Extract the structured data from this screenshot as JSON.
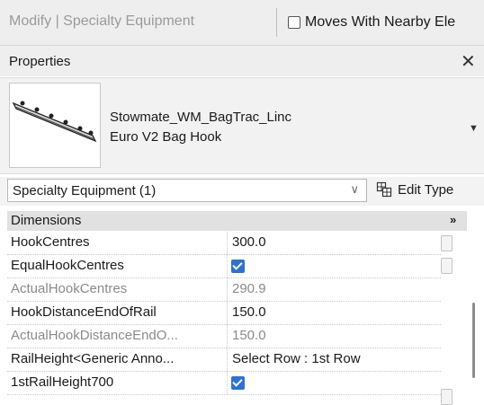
{
  "ribbon": {
    "title": "Modify | Specialty Equipment",
    "moves_with_label": "Moves With Nearby Ele"
  },
  "properties": {
    "title": "Properties",
    "type_name_line1": "Stowmate_WM_BagTrac_Linc",
    "type_name_line2": "Euro V2 Bag Hook",
    "filter_value": "Specialty Equipment (1)",
    "edit_type_label": "Edit Type",
    "section": "Dimensions",
    "rows": [
      {
        "name": "HookCentres",
        "value": "300.0",
        "kind": "text",
        "readonly": false
      },
      {
        "name": "EqualHookCentres",
        "value": "",
        "kind": "checkbox",
        "checked": true,
        "readonly": false
      },
      {
        "name": "ActualHookCentres",
        "value": "290.9",
        "kind": "text",
        "readonly": true
      },
      {
        "name": "HookDistanceEndOfRail",
        "value": "150.0",
        "kind": "text",
        "readonly": false
      },
      {
        "name": "ActualHookDistanceEndO...",
        "value": "150.0",
        "kind": "text",
        "readonly": true
      },
      {
        "name": "RailHeight<Generic Anno...",
        "value": "Select Row : 1st Row",
        "kind": "text",
        "readonly": false
      },
      {
        "name": "1stRailHeight700",
        "value": "",
        "kind": "checkbox",
        "checked": true,
        "readonly": false
      }
    ]
  },
  "colors": {
    "checkbox": "#2d72d2",
    "readonly_text": "#8a8a8a",
    "section_bg": "#e1e1e1"
  }
}
